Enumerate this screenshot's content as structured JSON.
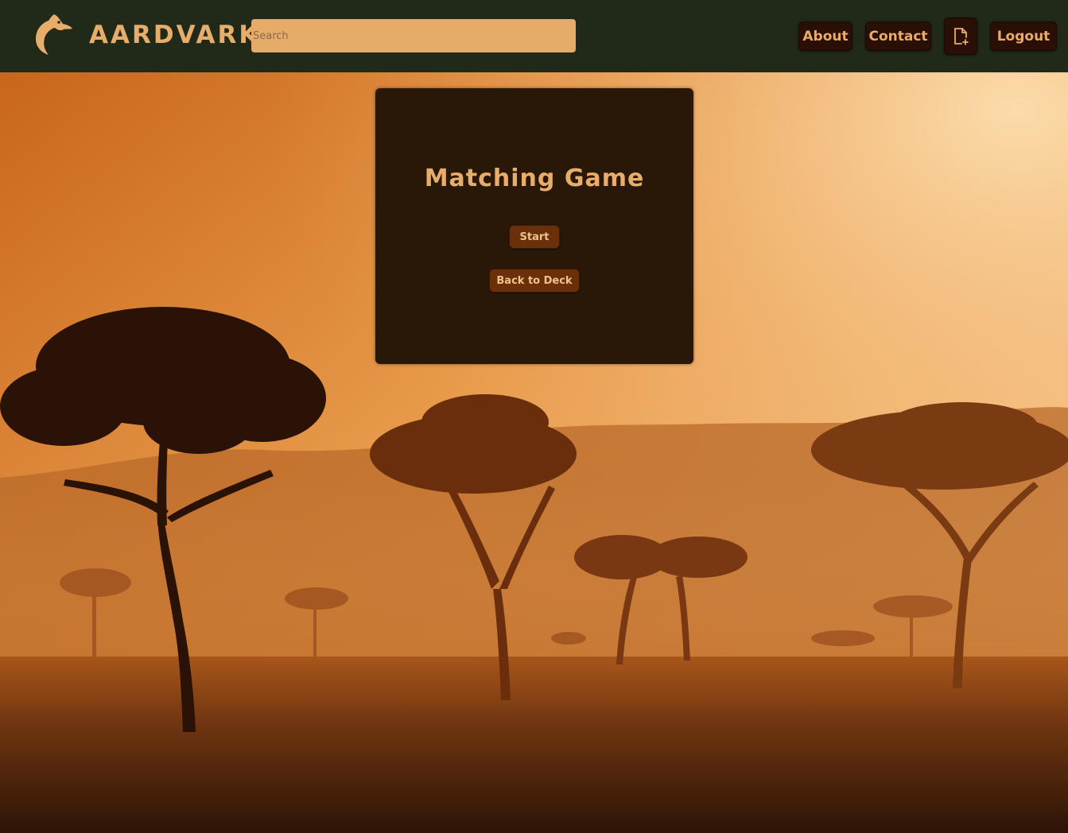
{
  "app": {
    "brand": "AARDVARK"
  },
  "header": {
    "search": {
      "placeholder": "Search",
      "value": ""
    },
    "nav": {
      "about": "About",
      "contact": "Contact",
      "new_doc_icon": "file-plus-icon",
      "logout": "Logout"
    }
  },
  "game": {
    "title": "Matching Game",
    "start_label": "Start",
    "back_label": "Back to Deck"
  },
  "colors": {
    "navbar_bg": "#212a18",
    "accent": "#e8ad6a",
    "search_bg": "#e6ab69",
    "card_bg": "#291807",
    "nav_button_bg": "#2a0f07",
    "card_button_bg": "#6a3009"
  }
}
